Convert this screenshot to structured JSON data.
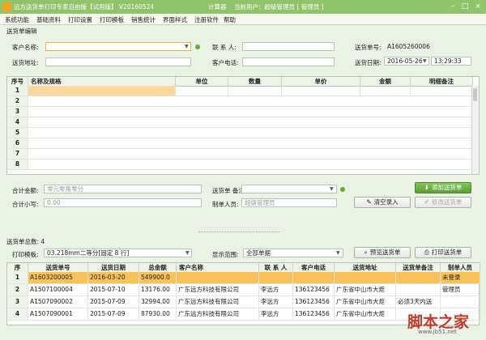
{
  "titlebar": {
    "title": "远方送货单打印专家自由版【试用版】 V20160524",
    "calculator": "计算器",
    "current_user": "当前用户：超级管理员 [ 管理员 ]",
    "min": "–",
    "max": "□",
    "close": "×"
  },
  "menu": [
    "系统功能",
    "基础资料",
    "打印设置",
    "打印模板",
    "销售统计",
    "界面样式",
    "注册软件",
    "帮助"
  ],
  "edit": {
    "section_title": "送货单编辑",
    "customer_name_label": "客户名称:",
    "customer_name_value": "",
    "contact_label": "联 系 人:",
    "contact_value": "",
    "order_no_label": "送货单号:",
    "order_no_value": "A1605260006",
    "address_label": "送货地址:",
    "address_value": "",
    "phone_label": "客户电话:",
    "phone_value": "",
    "date_label": "送货日期:",
    "date_value": "2016-05-26",
    "time_value": "13:29:33"
  },
  "items_grid": {
    "headers": [
      "序号",
      "名称及规格",
      "单位",
      "数量",
      "单价",
      "金额",
      "明细备注"
    ],
    "rows": [
      "1",
      "2",
      "3",
      "4",
      "5",
      "6",
      "7",
      "8"
    ]
  },
  "totals": {
    "total_label": "合计金额:",
    "total_placeholder": "零元零角零分",
    "small_label": "合计小写:",
    "small_value": "0.00",
    "remark_label": "送货单 备注",
    "remark_value": "",
    "maker_label": "制单人员:",
    "maker_value": "超级管理员",
    "add_btn": "添加送货单",
    "clear_btn": "清空录入",
    "modify_btn": "修改送货单"
  },
  "list": {
    "total_label": "送货单总数: 4",
    "template_label": "打印模板:",
    "template_value": "03.218mm二等分[固定 8 行]",
    "scope_label": "显示范围:",
    "scope_value": "全部单据",
    "preview_btn": "预览送货单",
    "print_btn": "打印送货单",
    "headers": [
      "序",
      "送货单号",
      "送货日期",
      "总金额",
      "客户名称",
      "联 系 人",
      "客户电话",
      "送货地址",
      "送货单备注",
      "制单人员"
    ],
    "rows": [
      {
        "seq": "1",
        "no": "A1603200005",
        "date": "2016-03-20",
        "amount": "549900.0",
        "customer": "",
        "contact": "",
        "phone": "",
        "address": "",
        "remark": "",
        "maker": "未登录"
      },
      {
        "seq": "2",
        "no": "A1507100004",
        "date": "2015-07-10",
        "amount": "13176.00",
        "customer": "广东远方科技有限公司",
        "contact": "李远方",
        "phone": "136123456",
        "address": "广东省中山市大炬",
        "remark": "",
        "maker": "管理员"
      },
      {
        "seq": "3",
        "no": "A1507090002",
        "date": "2015-07-09",
        "amount": "32994.00",
        "customer": "广东远方科技有限公司",
        "contact": "李远方",
        "phone": "136123456",
        "address": "广东省中山市大炬",
        "remark": "必须3天内送",
        "maker": ""
      },
      {
        "seq": "4",
        "no": "A1507090001",
        "date": "2015-07-09",
        "amount": "87930.00",
        "customer": "广东远方科技有限公司",
        "contact": "李远方",
        "phone": "136123456",
        "address": "广东省中山市大炬",
        "remark": "",
        "maker": ""
      }
    ]
  },
  "watermark": {
    "text": "脚本之家",
    "url": "www.jb51.net"
  },
  "colors": {
    "titlebar": "#8fc46a",
    "highlight_row": "#f9c15a",
    "selected_cell": "#fcd7a0",
    "button_green": "#5a9e35"
  }
}
